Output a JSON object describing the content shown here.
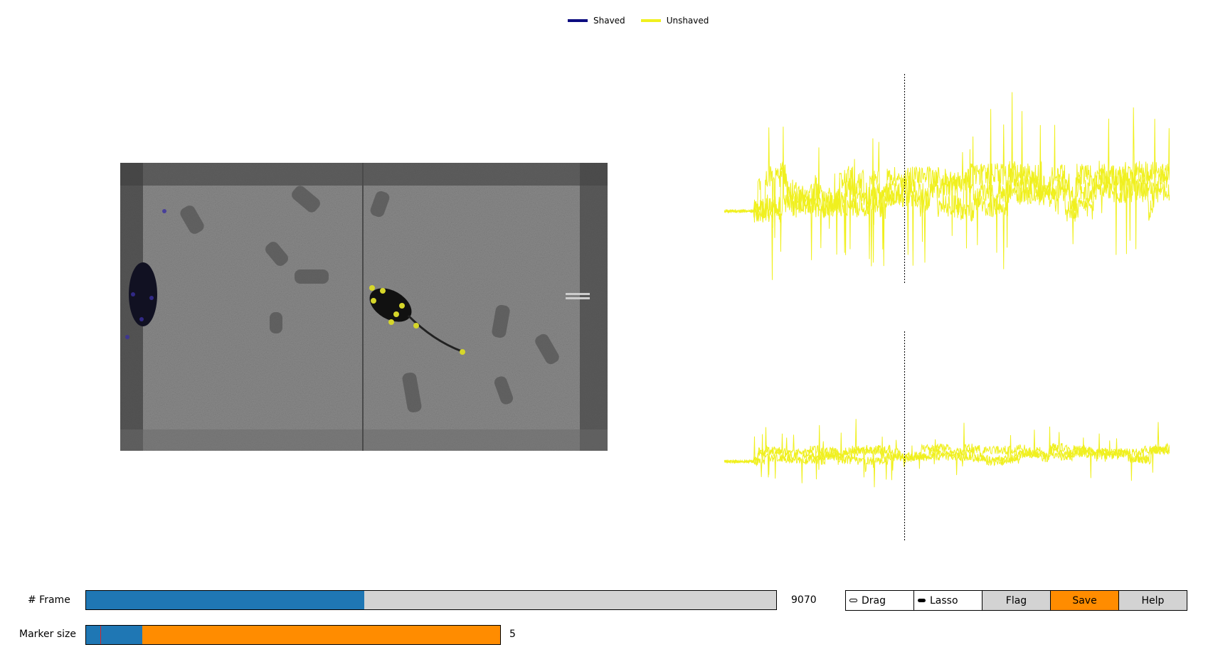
{
  "legend": [
    {
      "label": "Shaved",
      "color": "#0c0c80"
    },
    {
      "label": "Unshaved",
      "color": "#f0f01e"
    }
  ],
  "video": {
    "icon": "video-frame-image",
    "marker_colors": {
      "shaved": "#3a30a0",
      "unshaved": "#d6d62a"
    }
  },
  "traces": {
    "color": "#f0f01e",
    "current_frame_fraction": 0.405
  },
  "frame_slider": {
    "label": "# Frame",
    "value": "9070",
    "fraction": 0.403
  },
  "marker_slider": {
    "label": "Marker size",
    "value": "5",
    "fraction": 0.136,
    "handle_fraction": 0.034
  },
  "toolbar": {
    "drag_label": "Drag",
    "lasso_label": "Lasso",
    "flag_label": "Flag",
    "save_label": "Save",
    "help_label": "Help",
    "drag_selected": false,
    "lasso_selected": true
  }
}
